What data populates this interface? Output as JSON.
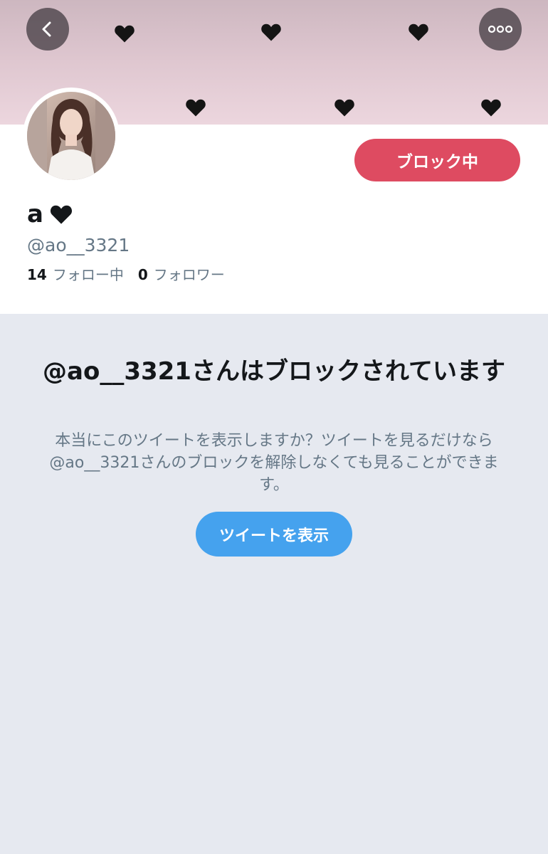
{
  "header": {
    "back_icon": "chevron-left-icon",
    "more_icon": "more-dots-icon",
    "banner_colors": [
      "#cdb7c0",
      "#ecd6de"
    ]
  },
  "profile": {
    "action_button_label": "ブロック中",
    "display_name": "a",
    "name_icon": "heart-icon",
    "handle": "@ao__3321",
    "following_count": "14",
    "following_label": "フォロー中",
    "followers_count": "0",
    "followers_label": "フォロワー"
  },
  "blocked_notice": {
    "title": "@ao__3321さんはブロックされています",
    "description": "本当にこのツイートを表示しますか？ツイートを見るだけなら@ao__3321さんのブロックを解除しなくても見ることができます。",
    "show_button_label": "ツイートを表示"
  },
  "colors": {
    "block_button": "#de4b61",
    "show_button": "#45a2ee",
    "page_background": "#e6e9f0"
  }
}
